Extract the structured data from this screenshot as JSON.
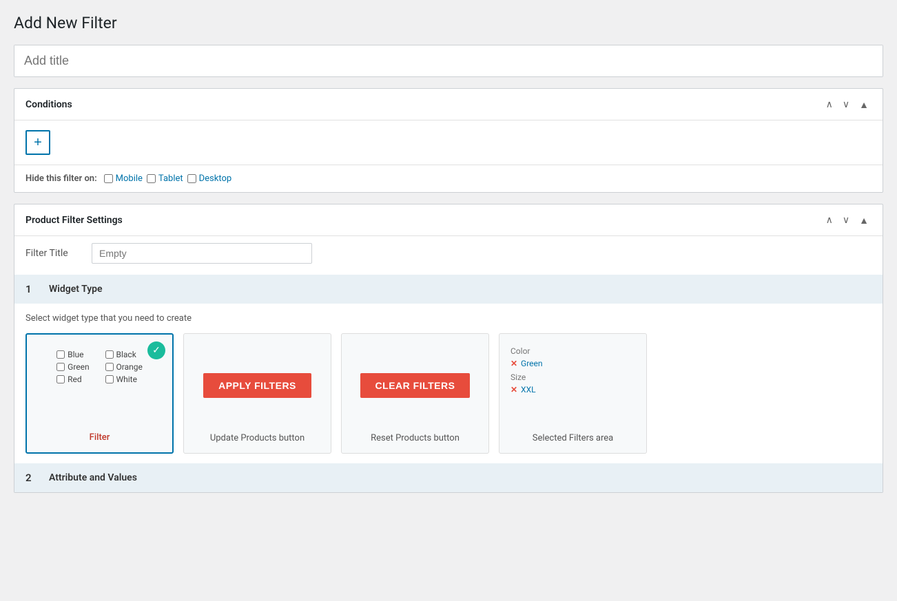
{
  "page": {
    "title": "Add New Filter"
  },
  "title_input": {
    "placeholder": "Add title",
    "value": ""
  },
  "conditions_panel": {
    "title": "Conditions",
    "add_button_label": "+",
    "hide_filter_label": "Hide this filter on:",
    "checkboxes": [
      {
        "id": "mobile",
        "label": "Mobile",
        "checked": false
      },
      {
        "id": "tablet",
        "label": "Tablet",
        "checked": false
      },
      {
        "id": "desktop",
        "label": "Desktop",
        "checked": false
      }
    ],
    "controls": {
      "up_arrow": "▲",
      "down_arrow": "▼",
      "collapse_arrow": "▲"
    }
  },
  "product_filter_panel": {
    "title": "Product Filter Settings",
    "filter_title_label": "Filter Title",
    "filter_title_placeholder": "Empty",
    "filter_title_value": "",
    "controls": {
      "up_arrow": "▲",
      "down_arrow": "▼",
      "collapse_arrow": "▲"
    },
    "section1": {
      "number": "1",
      "label": "Widget Type",
      "hint": "Select widget type that you need to create",
      "cards": [
        {
          "id": "filter",
          "label": "Filter",
          "selected": true,
          "type": "filter_checkboxes",
          "checkboxes": [
            {
              "label": "Blue"
            },
            {
              "label": "Black"
            },
            {
              "label": "Green"
            },
            {
              "label": "Orange"
            },
            {
              "label": "Red"
            },
            {
              "label": "White"
            }
          ]
        },
        {
          "id": "update_products",
          "label": "Update Products button",
          "selected": false,
          "type": "apply_button",
          "button_text": "APPLY FILTERS"
        },
        {
          "id": "reset_products",
          "label": "Reset Products button",
          "selected": false,
          "type": "clear_button",
          "button_text": "CLEAR FILTERS"
        },
        {
          "id": "selected_filters",
          "label": "Selected Filters area",
          "selected": false,
          "type": "selected_filters",
          "entries": [
            {
              "category": "Color",
              "value": "Green"
            },
            {
              "category": "Size",
              "value": "XXL"
            }
          ]
        }
      ]
    },
    "section2": {
      "number": "2",
      "label": "Attribute and Values"
    }
  },
  "icons": {
    "up": "&#8743;",
    "down": "&#8744;",
    "checkmark": "✓"
  }
}
